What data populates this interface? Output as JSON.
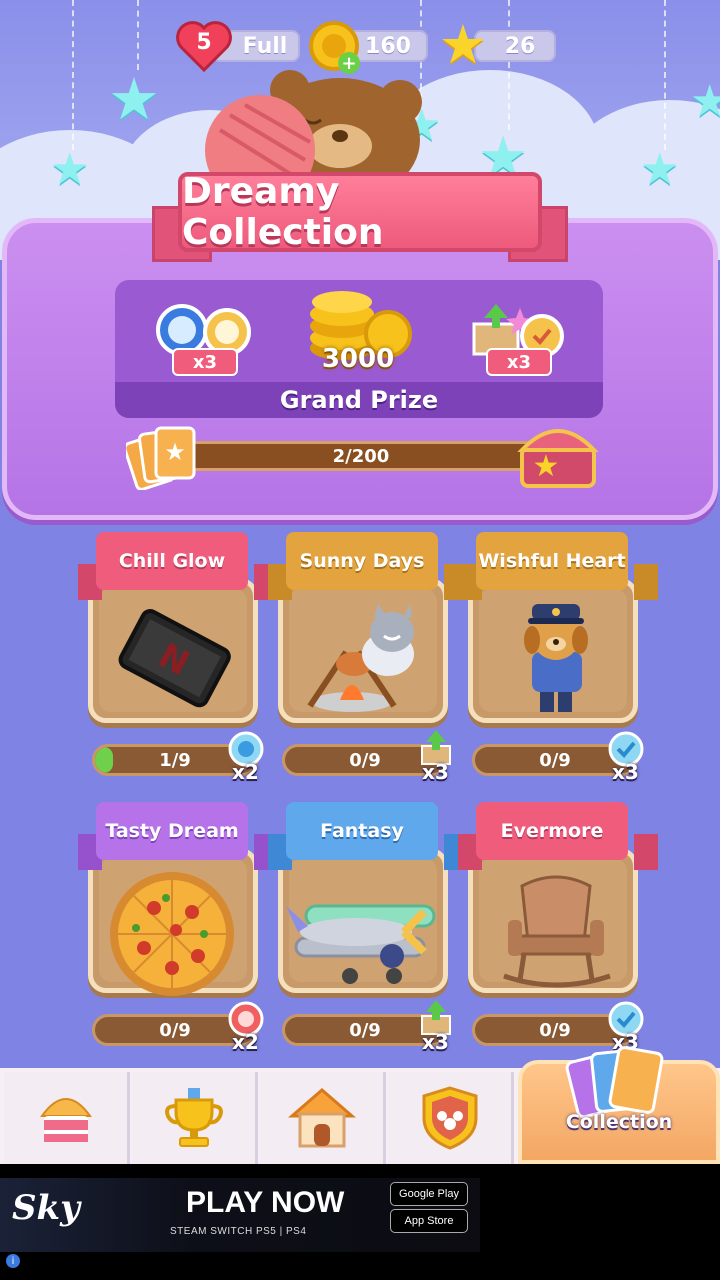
{
  "stats": {
    "lives": "5",
    "lives_status": "Full",
    "coins": "160",
    "stars": "26"
  },
  "title": "Dreamy Collection",
  "grand_prize": {
    "left_reward_mult": "x3",
    "coin_amount": "3000",
    "right_reward_mult": "x3",
    "label": "Grand Prize"
  },
  "collection_progress": {
    "text": "2/200",
    "fraction": 0.01
  },
  "albums": [
    {
      "name": "Chill Glow",
      "progress": "1/9",
      "fraction": 0.111,
      "reward_mult": "x2",
      "reward_icon": "blue-stopwatch-icon",
      "banner_color": "#ef5c7c",
      "item": "tablet"
    },
    {
      "name": "Sunny Days",
      "progress": "0/9",
      "fraction": 0,
      "reward_mult": "x3",
      "reward_icon": "box-arrow-icon",
      "banner_color": "#e3a33e",
      "item": "campfire-cat"
    },
    {
      "name": "Wishful Heart",
      "progress": "0/9",
      "fraction": 0,
      "reward_mult": "x3",
      "reward_icon": "checkmark-clock-icon",
      "banner_color": "#e3a33e",
      "item": "police-dog"
    },
    {
      "name": "Tasty Dream",
      "progress": "0/9",
      "fraction": 0,
      "reward_mult": "x2",
      "reward_icon": "red-stopwatch-icon",
      "banner_color": "#b672e8",
      "item": "pizza"
    },
    {
      "name": "Fantasy",
      "progress": "0/9",
      "fraction": 0,
      "reward_mult": "x3",
      "reward_icon": "box-arrow-icon",
      "banner_color": "#5fa8ec",
      "item": "biplane"
    },
    {
      "name": "Evermore",
      "progress": "0/9",
      "fraction": 0,
      "reward_mult": "x3",
      "reward_icon": "checkmark-clock-icon",
      "banner_color": "#ef5c7c",
      "item": "rocking-chair"
    }
  ],
  "nav": {
    "tabs": [
      {
        "icon": "shop-icon"
      },
      {
        "icon": "trophy-icon"
      },
      {
        "icon": "home-icon"
      },
      {
        "icon": "team-shield-icon"
      }
    ],
    "collection_label": "Collection"
  },
  "ad": {
    "logo": "Sky",
    "cta": "PLAY NOW",
    "platforms": "STEAM   SWITCH   PS5 | PS4",
    "google_play": "Google Play",
    "app_store": "App Store"
  }
}
